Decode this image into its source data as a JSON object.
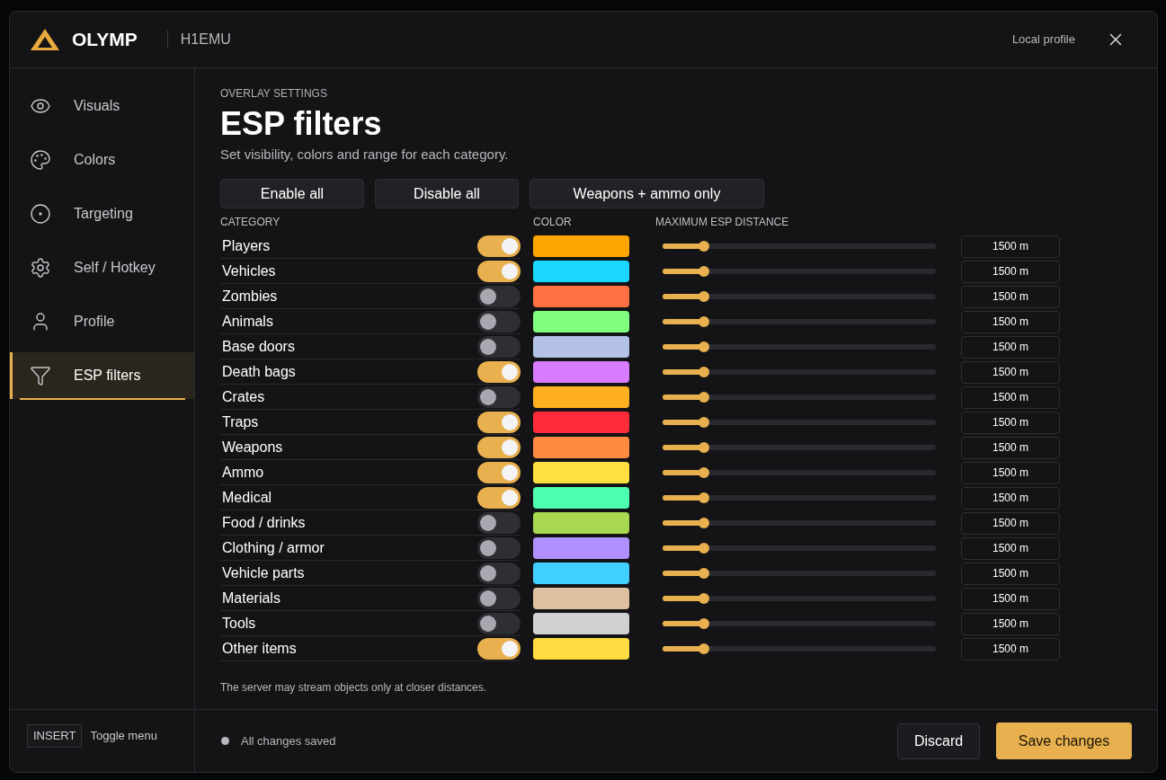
{
  "header": {
    "brand": "OLYMP",
    "game": "H1EMU",
    "profile": "Local profile"
  },
  "sidebar": {
    "items": [
      {
        "label": "Visuals",
        "selected": false
      },
      {
        "label": "Colors",
        "selected": false
      },
      {
        "label": "Targeting",
        "selected": false
      },
      {
        "label": "Self / Hotkey",
        "selected": false
      },
      {
        "label": "Profile",
        "selected": false
      },
      {
        "label": "ESP filters",
        "selected": true
      }
    ],
    "hotkey": "INSERT",
    "hotkey_label": "Toggle menu"
  },
  "page": {
    "eyebrow": "OVERLAY SETTINGS",
    "title": "ESP filters",
    "subtitle": "Set visibility, colors and range for each category.",
    "actions": [
      "Enable all",
      "Disable all",
      "Weapons + ammo only"
    ],
    "columns": [
      "CATEGORY",
      "COLOR",
      "MAXIMUM ESP DISTANCE"
    ],
    "rows": [
      {
        "name": "Players",
        "on": true,
        "color": "#ffa500",
        "level": 0.15,
        "reading": "1500 m"
      },
      {
        "name": "Vehicles",
        "on": true,
        "color": "#1ad7ff",
        "level": 0.15,
        "reading": "1500 m"
      },
      {
        "name": "Zombies",
        "on": false,
        "color": "#ff7043",
        "level": 0.15,
        "reading": "1500 m"
      },
      {
        "name": "Animals",
        "on": false,
        "color": "#80ff80",
        "level": 0.15,
        "reading": "1500 m"
      },
      {
        "name": "Base doors",
        "on": false,
        "color": "#b4c2e8",
        "level": 0.15,
        "reading": "1500 m"
      },
      {
        "name": "Death bags",
        "on": true,
        "color": "#d77bff",
        "level": 0.15,
        "reading": "1500 m"
      },
      {
        "name": "Crates",
        "on": false,
        "color": "#ffb020",
        "level": 0.15,
        "reading": "1500 m"
      },
      {
        "name": "Traps",
        "on": true,
        "color": "#ff2a3a",
        "level": 0.15,
        "reading": "1500 m"
      },
      {
        "name": "Weapons",
        "on": true,
        "color": "#ff8a40",
        "level": 0.15,
        "reading": "1500 m"
      },
      {
        "name": "Ammo",
        "on": true,
        "color": "#ffe040",
        "level": 0.15,
        "reading": "1500 m"
      },
      {
        "name": "Medical",
        "on": true,
        "color": "#4dffb0",
        "level": 0.15,
        "reading": "1500 m"
      },
      {
        "name": "Food / drinks",
        "on": false,
        "color": "#a8d850",
        "level": 0.15,
        "reading": "1500 m"
      },
      {
        "name": "Clothing / armor",
        "on": false,
        "color": "#b090ff",
        "level": 0.15,
        "reading": "1500 m"
      },
      {
        "name": "Vehicle parts",
        "on": false,
        "color": "#40d0ff",
        "level": 0.15,
        "reading": "1500 m"
      },
      {
        "name": "Materials",
        "on": false,
        "color": "#dcc0a0",
        "level": 0.15,
        "reading": "1500 m"
      },
      {
        "name": "Tools",
        "on": false,
        "color": "#d0d0d0",
        "level": 0.15,
        "reading": "1500 m"
      },
      {
        "name": "Other items",
        "on": true,
        "color": "#ffdc40",
        "level": 0.15,
        "reading": "1500 m"
      }
    ],
    "note": "The server may stream objects only at closer distances."
  },
  "footer": {
    "status": "All changes saved",
    "buttons": [
      "Discard",
      "Save changes"
    ]
  }
}
